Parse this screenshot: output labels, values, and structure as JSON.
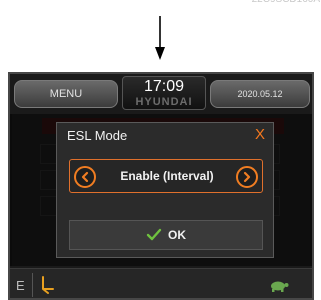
{
  "reference_code": "22C9SCD160A",
  "header": {
    "menu_label": "MENU",
    "time": "17:09",
    "brand": "HYUNDAI",
    "date": "2020.05.12"
  },
  "dialog": {
    "title": "ESL Mode",
    "close_label": "X",
    "selected_value": "Enable (Interval)",
    "ok_label": "OK"
  },
  "statusbar": {
    "mode_letter": "E"
  },
  "colors": {
    "accent": "#f07d22",
    "ok_check": "#6fc23f",
    "screen_bg": "#1a1a1a"
  },
  "icons": [
    "down-arrow-icon",
    "prev-option-icon",
    "next-option-icon",
    "check-icon",
    "pedal-icon",
    "turtle-icon"
  ]
}
